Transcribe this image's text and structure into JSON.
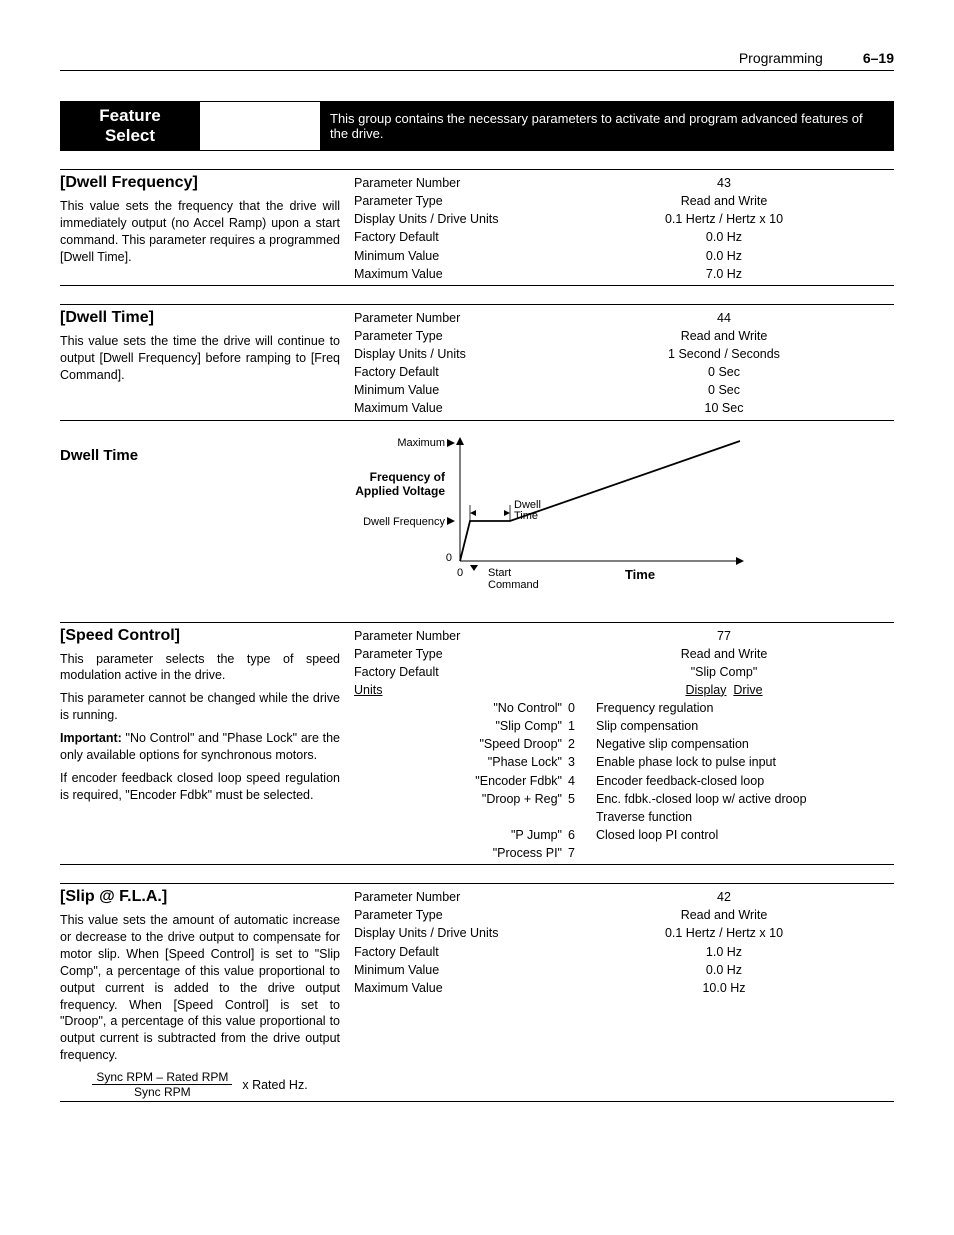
{
  "header": {
    "section": "Programming",
    "page": "6–19"
  },
  "feature": {
    "title_l1": "Feature",
    "title_l2": "Select",
    "desc": "This group contains the necessary parameters to activate and program advanced features of the drive."
  },
  "p1": {
    "title": "[Dwell Frequency]",
    "desc": "This value sets the frequency that the drive will immediately output (no Accel Ramp) upon a start command. This parameter requires a programmed [Dwell Time].",
    "labels": [
      "Parameter Number",
      "Parameter Type",
      "Display Units / Drive Units",
      "Factory Default",
      "Minimum Value",
      "Maximum Value"
    ],
    "values": [
      "43",
      "Read and Write",
      "0.1 Hertz / Hertz x 10",
      "0.0 Hz",
      "0.0 Hz",
      "7.0 Hz"
    ]
  },
  "p2": {
    "title": "[Dwell Time]",
    "desc": "This value sets the time the drive will continue to output [Dwell Frequency] before ramping to [Freq Command].",
    "labels": [
      "Parameter Number",
      "Parameter Type",
      "Display Units / Units",
      "Factory Default",
      "Minimum Value",
      "Maximum Value"
    ],
    "values": [
      "44",
      "Read and Write",
      "1 Second / Seconds",
      "0 Sec",
      "0 Sec",
      "10 Sec"
    ]
  },
  "dwell_heading": "Dwell Time",
  "p3": {
    "title": "[Speed Control]",
    "desc1": "This parameter selects the type of speed modulation active in the drive.",
    "desc2": "This parameter cannot be changed while the drive is running.",
    "desc3a": "Important:",
    "desc3b": " \"No Control\" and \"Phase Lock\" are the only available options for synchronous motors.",
    "desc4": "If encoder feedback closed loop speed regulation is required, \"Encoder Fdbk\" must be selected.",
    "labels": [
      "Parameter Number",
      "Parameter Type",
      "Factory Default"
    ],
    "units_label": "Units",
    "values": [
      "77",
      "Read and Write",
      "\"Slip Comp\""
    ],
    "units_header_l": "Display",
    "units_header_r": "Drive",
    "options": [
      {
        "d": "\"No Control\"",
        "n": "0",
        "e": "Frequency regulation"
      },
      {
        "d": "\"Slip Comp\"",
        "n": "1",
        "e": "Slip compensation"
      },
      {
        "d": "\"Speed Droop\"",
        "n": "2",
        "e": "Negative slip compensation"
      },
      {
        "d": "\"Phase Lock\"",
        "n": "3",
        "e": "Enable phase lock to pulse input"
      },
      {
        "d": "\"Encoder Fdbk\"",
        "n": "4",
        "e": "Encoder feedback-closed loop"
      },
      {
        "d": "\"Droop + Reg\"",
        "n": "5",
        "e": "Enc. fdbk.-closed loop w/ active droop"
      },
      {
        "d": "\"P Jump\"",
        "n": "6",
        "e": "Traverse function"
      },
      {
        "d": "\"Process PI\"",
        "n": "7",
        "e": "Closed loop PI control"
      }
    ]
  },
  "p4": {
    "title": "[Slip @ F.L.A.]",
    "desc": "This value sets the amount of automatic increase or decrease to the drive output to compensate for motor slip. When [Speed Control] is set to \"Slip Comp\", a percentage of this value proportional to output current is added to the drive output frequency. When [Speed Control] is set to \"Droop\", a percentage of this value proportional to output current is subtracted from the drive output frequency.",
    "formula_num": "Sync RPM – Rated RPM",
    "formula_den": "Sync RPM",
    "formula_rhs": "x Rated Hz.",
    "labels": [
      "Parameter Number",
      "Parameter Type",
      "Display Units / Drive Units",
      "Factory Default",
      "Minimum Value",
      "Maximum Value"
    ],
    "values": [
      "42",
      "Read and Write",
      "0.1 Hertz / Hertz x 10",
      "1.0 Hz",
      "0.0 Hz",
      "10.0 Hz"
    ]
  },
  "chart_data": {
    "type": "line",
    "title": "Dwell Time",
    "xlabel": "Time",
    "ylabel": "Frequency of Applied Voltage",
    "y_ticks": [
      "0",
      "Dwell Frequency",
      "Maximum"
    ],
    "x_ticks": [
      "0",
      "Start Command"
    ],
    "annotations": [
      "Dwell Time"
    ],
    "series": [
      {
        "name": "freq",
        "points": [
          [
            0,
            0
          ],
          [
            0.05,
            0.25
          ],
          [
            0.25,
            0.25
          ],
          [
            1.0,
            1.0
          ]
        ]
      }
    ]
  }
}
